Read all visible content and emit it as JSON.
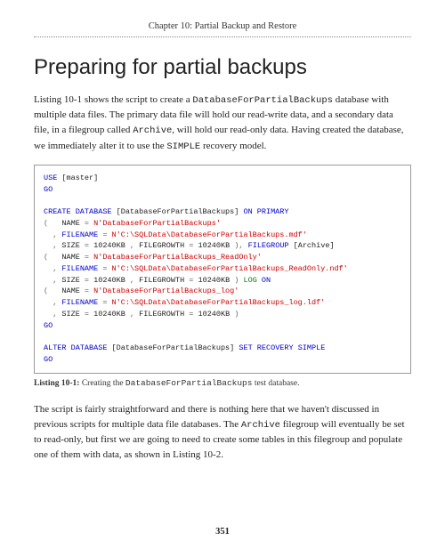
{
  "chapter_header": "Chapter 10: Partial Backup and Restore",
  "section_title": "Preparing for partial backups",
  "intro_para": {
    "t1": "Listing 10-1 shows the script to create a ",
    "db1": "DatabaseForPartialBackups",
    "t2": " database with multiple data files. The primary data file will hold our read-write data, and a secondary data file, in a filegroup called ",
    "fg": "Archive",
    "t3": ", will hold our read-only data. Having created the database, we immediately alter it to use the ",
    "rm": "SIMPLE",
    "t4": " recovery model."
  },
  "code": {
    "l01a": "USE",
    "l01b": " [master]",
    "l02": "GO",
    "l04a": "CREATE",
    "l04b": " DATABASE",
    "l04c": " [DatabaseForPartialBackups] ",
    "l04d": "ON",
    "l04e": " PRIMARY",
    "l05a": "(",
    "l05b": "   NAME ",
    "l05c": "=",
    "l05d": " N'DatabaseForPartialBackups'",
    "l06a": "  ",
    "l06b": ",",
    "l06c": " FILENAME ",
    "l06d": "=",
    "l06e": " N'C:\\SQLData\\DatabaseForPartialBackups.mdf'",
    "l07a": "  ",
    "l07b": ",",
    "l07c": " SIZE ",
    "l07d": "=",
    "l07e": " 10240KB ",
    "l07f": ",",
    "l07g": " FILEGROWTH ",
    "l07h": "=",
    "l07i": " 10240KB ",
    "l07j": "),",
    "l07k": " FILEGROUP",
    "l07l": " [Archive]",
    "l08a": "(",
    "l08b": "   NAME ",
    "l08c": "=",
    "l08d": " N'DatabaseForPartialBackups_ReadOnly'",
    "l09a": "  ",
    "l09b": ",",
    "l09c": " FILENAME ",
    "l09d": "=",
    "l09e": " N'C:\\SQLData\\DatabaseForPartialBackups_ReadOnly.ndf'",
    "l10a": "  ",
    "l10b": ",",
    "l10c": " SIZE ",
    "l10d": "=",
    "l10e": " 10240KB ",
    "l10f": ",",
    "l10g": " FILEGROWTH ",
    "l10h": "=",
    "l10i": " 10240KB ",
    "l10j": ")",
    "l10k": " LOG",
    "l10l": " ON",
    "l11a": "(",
    "l11b": "   NAME ",
    "l11c": "=",
    "l11d": " N'DatabaseForPartialBackups_log'",
    "l12a": "  ",
    "l12b": ",",
    "l12c": " FILENAME ",
    "l12d": "=",
    "l12e": " N'C:\\SQLData\\DatabaseForPartialBackups_log.ldf'",
    "l13a": "  ",
    "l13b": ",",
    "l13c": " SIZE ",
    "l13d": "=",
    "l13e": " 10240KB ",
    "l13f": ",",
    "l13g": " FILEGROWTH ",
    "l13h": "=",
    "l13i": " 10240KB ",
    "l13j": ")",
    "l14": "GO",
    "l16a": "ALTER",
    "l16b": " DATABASE",
    "l16c": " [DatabaseForPartialBackups] ",
    "l16d": "SET",
    "l16e": " RECOVERY",
    "l16f": " SIMPLE",
    "l17": "GO"
  },
  "listing_caption": {
    "label": "Listing 10-1:",
    "t1": "  Creating the ",
    "db": "DatabaseForPartialBackups",
    "t2": " test database."
  },
  "outro_para": {
    "t1": "The script is fairly straightforward and there is nothing here that we haven't discussed in previous scripts for multiple data file databases. The ",
    "fg": "Archive",
    "t2": " filegroup will eventually be set to read-only, but first we are going to need to create some tables in this filegroup and populate one of them with data, as shown in Listing 10-2."
  },
  "page_number": "351"
}
